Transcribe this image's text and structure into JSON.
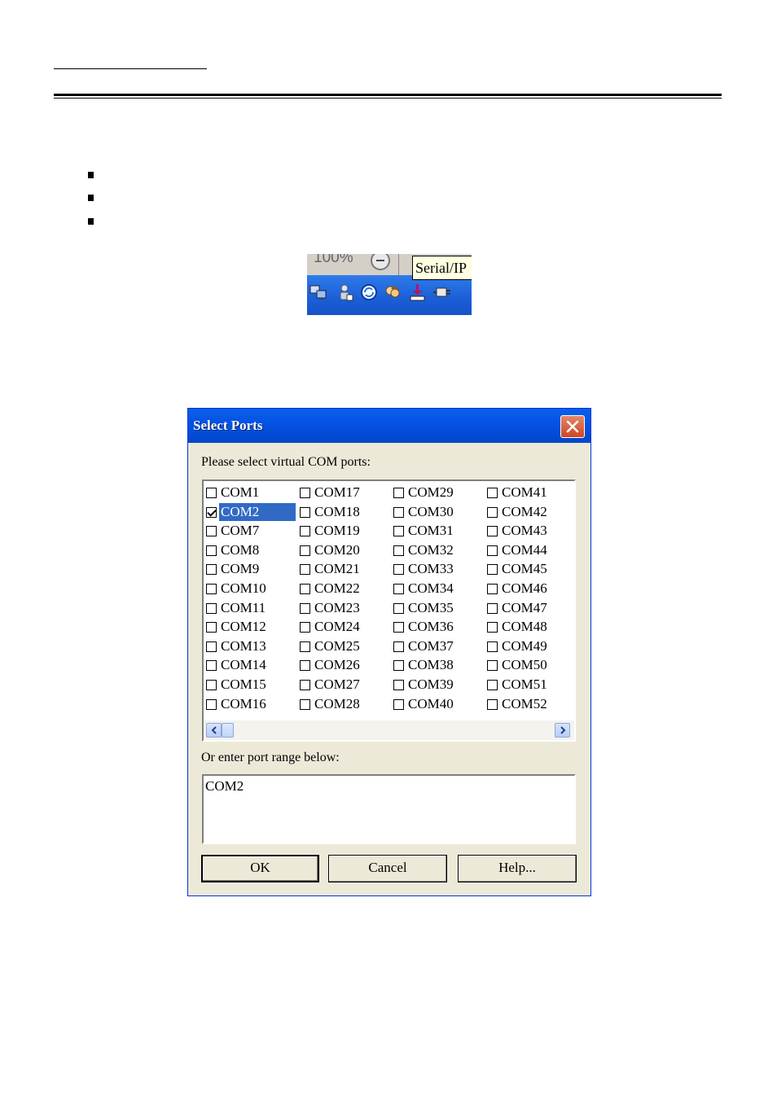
{
  "taskbar": {
    "zoom_text": "100%",
    "tooltip": "Serial/IP",
    "tray_icons": [
      "network-icon",
      "user-icon",
      "sync-icon",
      "people-icon",
      "serial-ip-icon",
      "plug-icon"
    ]
  },
  "dialog": {
    "title": "Select Ports",
    "select_label": "Please select virtual COM ports:",
    "columns": [
      [
        "COM1",
        "COM2",
        "COM7",
        "COM8",
        "COM9",
        "COM10",
        "COM11",
        "COM12",
        "COM13",
        "COM14",
        "COM15",
        "COM16"
      ],
      [
        "COM17",
        "COM18",
        "COM19",
        "COM20",
        "COM21",
        "COM22",
        "COM23",
        "COM24",
        "COM25",
        "COM26",
        "COM27",
        "COM28"
      ],
      [
        "COM29",
        "COM30",
        "COM31",
        "COM32",
        "COM33",
        "COM34",
        "COM35",
        "COM36",
        "COM37",
        "COM38",
        "COM39",
        "COM40"
      ],
      [
        "COM41",
        "COM42",
        "COM43",
        "COM44",
        "COM45",
        "COM46",
        "COM47",
        "COM48",
        "COM49",
        "COM50",
        "COM51",
        "COM52"
      ]
    ],
    "checked_ports": [
      "COM2"
    ],
    "selected_port": "COM2",
    "range_label": "Or enter port range below:",
    "range_value": "COM2",
    "ok_label": "OK",
    "cancel_label": "Cancel",
    "help_label": "Help..."
  },
  "colors": {
    "titlebar": "#0553e6",
    "selection": "#316ac5",
    "dialog_bg": "#ece9d8",
    "taskbar_blue": "#1b5ed6"
  }
}
